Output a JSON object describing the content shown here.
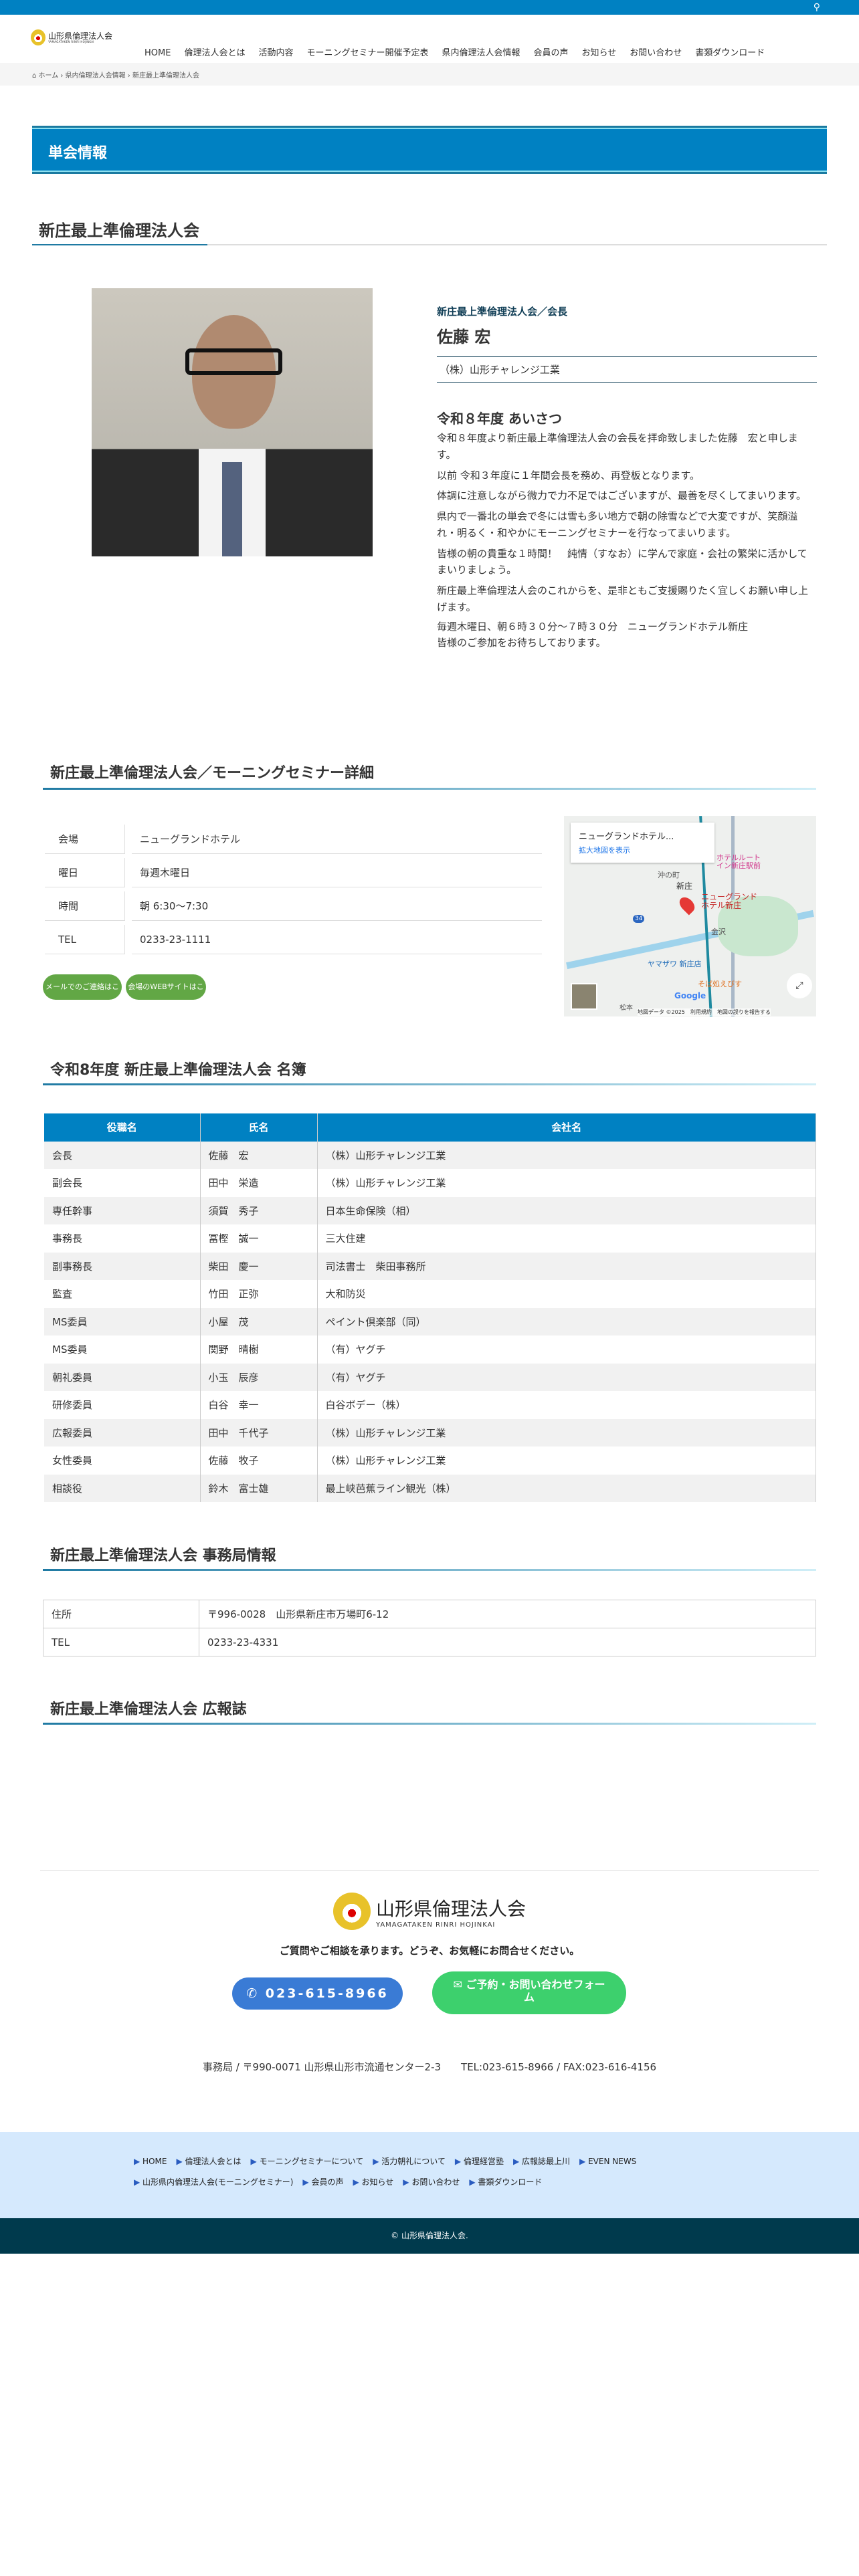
{
  "header": {
    "site_name": "山形県倫理法人会",
    "site_sub": "YAMAGATAKEN RINRI HOJINKAI",
    "search_icon": "search-icon",
    "nav": [
      "HOME",
      "倫理法人会とは",
      "活動内容",
      "モーニングセミナー開催予定表",
      "県内倫理法人会情報",
      "会員の声",
      "お知らせ",
      "お問い合わせ",
      "書類ダウンロード"
    ]
  },
  "breadcrumb": [
    "ホーム",
    "県内倫理法人会情報",
    "新庄最上準倫理法人会"
  ],
  "page_title": "単会情報",
  "unit_title": "新庄最上準倫理法人会",
  "president": {
    "role": "新庄最上準倫理法人会／会長",
    "name": "佐藤 宏",
    "company": "（株）山形チャレンジ工業",
    "greeting_title": "令和８年度 あいさつ",
    "paragraphs": [
      "令和８年度より新庄最上準倫理法人会の会長を拝命致しました佐藤　宏と申します。",
      "以前 令和３年度に１年間会長を務め、再登板となります。",
      "体調に注意しながら微力で力不足ではございますが、最善を尽くしてまいります。",
      "県内で一番北の単会で冬には雪も多い地方で朝の除雪などで大変ですが、笑顔溢れ・明るく・和やかにモーニングセミナーを行なってまいります。",
      "皆様の朝の貴重な１時間！　純情（すなお）に学んで家庭・会社の繁栄に活かしてまいりましょう。",
      "新庄最上準倫理法人会のこれからを、是非ともご支援賜りたく宜しくお願い申し上げます。",
      "毎週木曜日、朝６時３０分～７時３０分　ニューグランドホテル新庄",
      "皆様のご参加をお待ちしております。"
    ]
  },
  "seminar": {
    "title": "新庄最上準倫理法人会／モーニングセミナー詳細",
    "rows": [
      {
        "label": "会場",
        "value": "ニューグランドホテル"
      },
      {
        "label": "曜日",
        "value": "毎週木曜日"
      },
      {
        "label": "時間",
        "value": "朝 6:30〜7:30"
      },
      {
        "label": "TEL",
        "value": "0233-23-1111"
      }
    ],
    "buttons": [
      "メールでのご連絡はこちら",
      "会場のWEBサイトはこちら"
    ],
    "button_color": "#62a745",
    "map": {
      "place": "ニューグランドホテル...",
      "link": "拡大地図を表示",
      "marker": "ニューグランド\nホテル新庄",
      "labels": [
        "沖の町",
        "新庄",
        "金沢",
        "ヤマザワ 新庄店",
        "ホテルルート\nイン新庄駅前",
        "そば処えびす",
        "松本",
        "34"
      ],
      "credit": "地図データ ©2025",
      "terms": "利用規約",
      "report": "地図の誤りを報告する",
      "brand": "Google"
    }
  },
  "roster": {
    "title": "令和8年度 新庄最上準倫理法人会 名簿",
    "headers": [
      "役職名",
      "氏名",
      "会社名"
    ],
    "rows": [
      [
        "会長",
        "佐藤　宏",
        "（株）山形チャレンジ工業"
      ],
      [
        "副会長",
        "田中　栄造",
        "（株）山形チャレンジ工業"
      ],
      [
        "専任幹事",
        "須賀　秀子",
        "日本生命保険（相）"
      ],
      [
        "事務長",
        "冨樫　誠一",
        "三大住建"
      ],
      [
        "副事務長",
        "柴田　慶一",
        "司法書士　柴田事務所"
      ],
      [
        "監査",
        "竹田　正弥",
        "大和防災"
      ],
      [
        "MS委員",
        "小屋　茂",
        "ペイント倶楽部（同）"
      ],
      [
        "MS委員",
        "関野　晴樹",
        "（有）ヤグチ"
      ],
      [
        "朝礼委員",
        "小玉　辰彦",
        "（有）ヤグチ"
      ],
      [
        "研修委員",
        "白谷　幸一",
        "白谷ボデー（株）"
      ],
      [
        "広報委員",
        "田中　千代子",
        "（株）山形チャレンジ工業"
      ],
      [
        "女性委員",
        "佐藤　牧子",
        "（株）山形チャレンジ工業"
      ],
      [
        "相談役",
        "鈴木　富士雄",
        "最上峡芭蕉ライン観光（株）"
      ]
    ]
  },
  "office": {
    "title": "新庄最上準倫理法人会 事務局情報",
    "rows": [
      {
        "label": "住所",
        "value": "〒996-0028　山形県新庄市万場町6-12"
      },
      {
        "label": "TEL",
        "value": "0233-23-4331"
      }
    ]
  },
  "magazine": {
    "title": "新庄最上準倫理法人会 広報誌"
  },
  "contact": {
    "message": "ご質問やご相談を承ります。どうぞ、お気軽にお問合せください。",
    "phone": "023-615-8966",
    "form": "ご予約・お問い合わせフォーム",
    "phone_color": "#3a7bd5",
    "form_color": "#3dd06d",
    "address": "事務局 / 〒990-0071 山形県山形市流通センター2-3　　TEL:023-615-8966 / FAX:023-616-4156"
  },
  "footer_nav": [
    [
      "HOME",
      "倫理法人会とは",
      "モーニングセミナーについて",
      "活力朝礼について",
      "倫理経営塾",
      "広報誌最上川",
      "EVEN NEWS"
    ],
    [
      "山形県内倫理法人会(モーニングセミナー)",
      "会員の声",
      "お知らせ",
      "お問い合わせ",
      "書類ダウンロード"
    ]
  ],
  "copyright": "© 山形県倫理法人会."
}
